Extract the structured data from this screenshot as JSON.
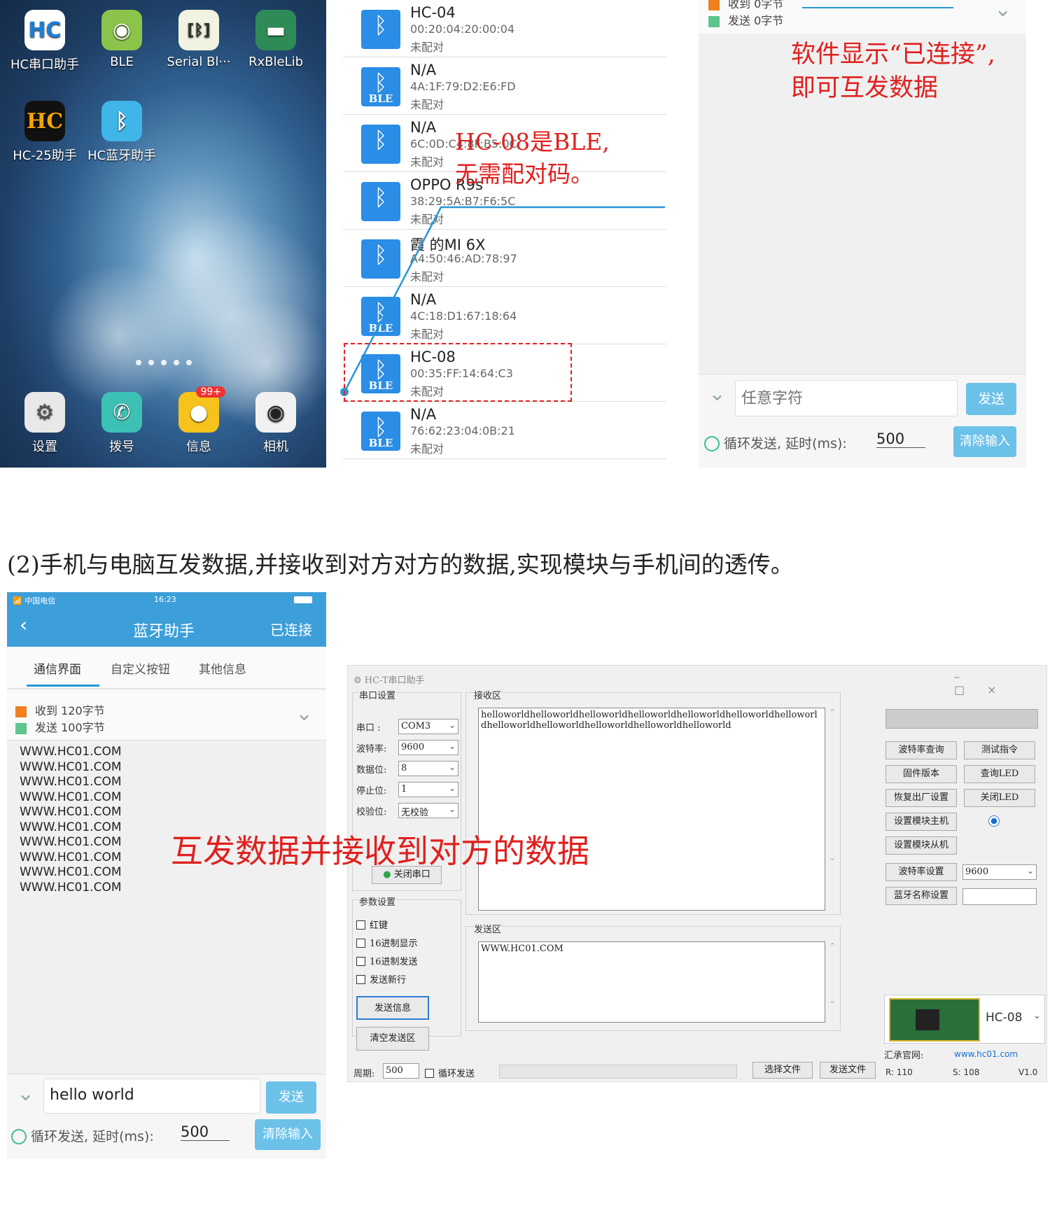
{
  "home": {
    "apps": [
      "HC串口助手",
      "BLE",
      "Serial Bl···",
      "RxBleLib",
      "HC-25助手",
      "HC蓝牙助手"
    ],
    "dock": [
      "设置",
      "拨号",
      "信息",
      "相机"
    ],
    "badge": "99+"
  },
  "devices": [
    {
      "name": "HC-04",
      "mac": "00:20:04:20:00:04",
      "status": "未配对",
      "ble": ""
    },
    {
      "name": "N/A",
      "mac": "4A:1F:79:D2:E6:FD",
      "status": "未配对",
      "ble": "BLE"
    },
    {
      "name": "N/A",
      "mac": "6C:0D:C4:8F:B5:0C",
      "status": "未配对",
      "ble": ""
    },
    {
      "name": "OPPO R9s",
      "mac": "38:29:5A:B7:F6:5C",
      "status": "未配对",
      "ble": ""
    },
    {
      "name": "霞   的MI 6X",
      "mac": "A4:50:46:AD:78:97",
      "status": "未配对",
      "ble": ""
    },
    {
      "name": "N/A",
      "mac": "4C:18:D1:67:18:64",
      "status": "未配对",
      "ble": "BLE"
    },
    {
      "name": "HC-08",
      "mac": "00:35:FF:14:64:C3",
      "status": "未配对",
      "ble": "BLE"
    },
    {
      "name": "N/A",
      "mac": "76:62:23:04:0B:21",
      "status": "未配对",
      "ble": "BLE"
    }
  ],
  "note_ble": [
    "HC-08是BLE,",
    "无需配对码。"
  ],
  "conn": {
    "recv": "收到  0字节",
    "send": "发送  0字节",
    "note": [
      "软件显示“已连接”,",
      "即可互发数据"
    ],
    "placeholder": "任意字符",
    "send_btn": "发送",
    "loop": "循环发送, 延时(ms):",
    "delay": "500",
    "clear_btn": "清除输入"
  },
  "caption": "(2)手机与电脑互发数据,并接收到对方对方的数据,实现模块与手机间的透传。",
  "phone2": {
    "carrier": "中国电信",
    "time": "16:23",
    "title": "蓝牙助手",
    "connected": "已连接",
    "tabs": [
      "通信界面",
      "自定义按钮",
      "其他信息"
    ],
    "recv": "收到  120字节",
    "send": "发送  100字节",
    "lines": [
      "WWW.HC01.COM",
      "WWW.HC01.COM",
      "WWW.HC01.COM",
      "WWW.HC01.COM",
      "WWW.HC01.COM",
      "WWW.HC01.COM",
      "WWW.HC01.COM",
      "WWW.HC01.COM",
      "WWW.HC01.COM",
      "WWW.HC01.COM"
    ],
    "input": "hello world",
    "send_btn": "发送",
    "loop": "循环发送, 延时(ms):",
    "delay": "500",
    "clear_btn": "清除输入"
  },
  "overlay_note": "互发数据并接收到对方的数据",
  "tool": {
    "title": "HC-T串口助手",
    "serial_group": "串口设置",
    "port_lbl": "串口  :",
    "port": "COM3",
    "baud_lbl": "波特率:",
    "baud": "9600",
    "data_lbl": "数据位:",
    "data": "8",
    "stop_lbl": "停止位:",
    "stop": "1",
    "parity_lbl": "校验位:",
    "parity": "无校验",
    "close_btn": "关闭串口",
    "param_group": "参数设置",
    "cbs": [
      "红键",
      "16进制显示",
      "16进制发送",
      "发送新行"
    ],
    "send_info": "发送信息",
    "clear_send": "清空发送区",
    "recv_group": "接收区",
    "recv_text": "helloworldhelloworldhelloworldhelloworldhelloworldhelloworldhelloworldhelloworldhelloworldhelloworldhelloworldhelloworld",
    "send_group": "发送区",
    "send_text": "WWW.HC01.COM",
    "period_lbl": "周期:",
    "period": "500",
    "loop": "循环发送",
    "choose_file": "选择文件",
    "send_file": "发送文件",
    "right_btns": [
      "波特率查询",
      "测试指令",
      "固件版本",
      "查询LED",
      "恢复出厂设置",
      "关闭LED",
      "设置模块主机",
      "",
      "设置模块从机",
      ""
    ],
    "baud_set": "波特率设置",
    "baud_set_val": "9600",
    "name_set": "蓝牙名称设置",
    "module": "HC-08",
    "site_lbl": "汇承官网:",
    "site": "www.hc01.com",
    "r": "R: 110",
    "s": "S: 108",
    "ver": "V1.0"
  }
}
